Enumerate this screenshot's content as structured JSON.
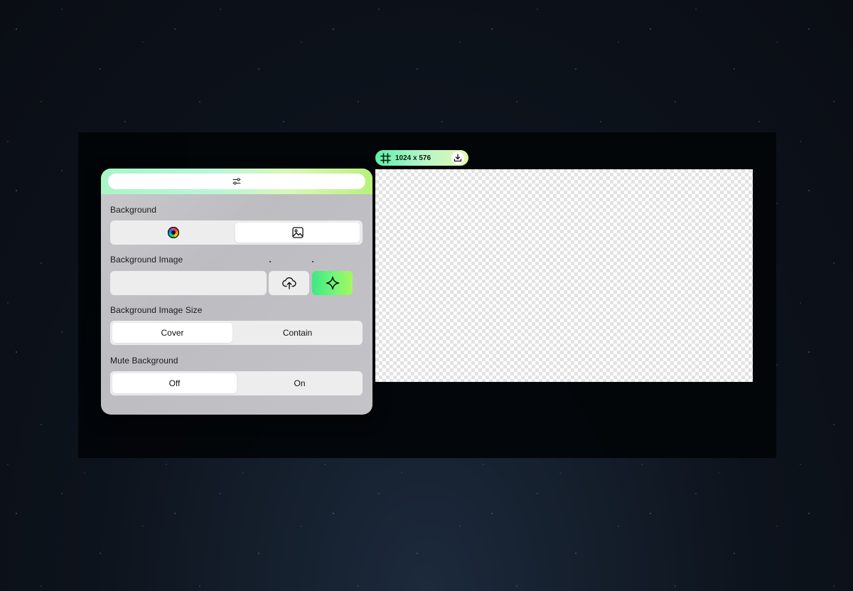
{
  "canvas": {
    "size_label": "1024 x 576"
  },
  "settings": {
    "background": {
      "label": "Background",
      "options": [
        "color",
        "image"
      ],
      "selected": "image"
    },
    "background_image": {
      "label": "Background Image",
      "url_value": "",
      "url_placeholder": ""
    },
    "background_image_size": {
      "label": "Background Image Size",
      "options": [
        "Cover",
        "Contain"
      ],
      "selected": "Cover"
    },
    "mute_background": {
      "label": "Mute Background",
      "options": [
        "Off",
        "On"
      ],
      "selected": "Off"
    }
  },
  "icons": {
    "header": "sliders-icon",
    "color": "color-wheel-icon",
    "image": "image-icon",
    "upload": "cloud-upload-icon",
    "generate": "sparkle-icon",
    "frame": "frame-grid-icon",
    "download": "download-icon"
  },
  "colors": {
    "accent_green": "#4ef08a",
    "accent_lime": "#a6f760",
    "panel_bg": "#c4c4c8",
    "segment_bg": "#ededee"
  }
}
